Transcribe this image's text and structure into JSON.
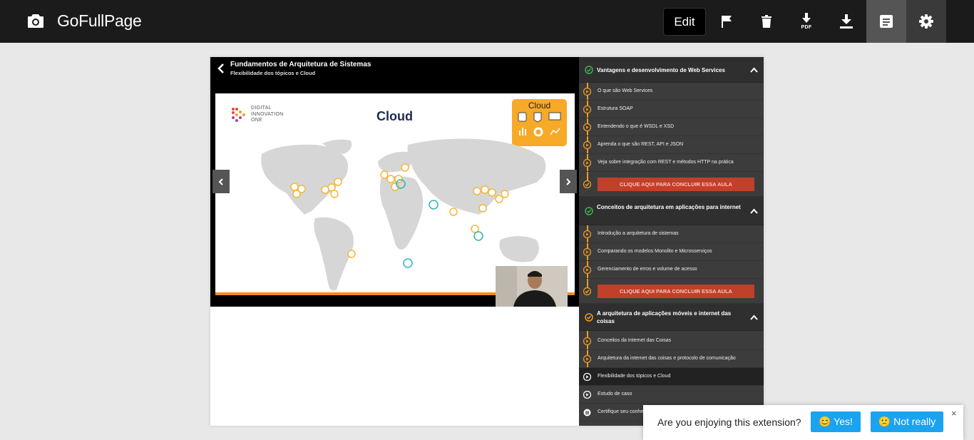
{
  "app": {
    "title": "GoFullPage",
    "edit_label": "Edit",
    "pdf_label": "PDF"
  },
  "course": {
    "title": "Fundamentos de Arquitetura de Sistemas",
    "subtitle": "Flexibilidade dos tópicos e Cloud"
  },
  "slide": {
    "title": "Cloud",
    "badge_label": "Cloud",
    "logo_lines": [
      "DIGITAL",
      "INNOVATION",
      "ONE"
    ]
  },
  "sections": [
    {
      "title": "Vantagens e desenvolvimento de Web Services",
      "status": "complete",
      "lessons": [
        "O que são Web Services",
        "Estrutura SOAP",
        "Entendendo o que é WSDL e XSD",
        "Aprenda o que são REST, API e JSON",
        "Veja sobre integração com REST e métodos HTTP na prática"
      ],
      "cta": "CLIQUE AQUI PARA CONCLUIR ESSA AULA"
    },
    {
      "title": "Conceitos de arquitetura em aplicações para internet",
      "status": "complete",
      "lessons": [
        "Introdução a arquitetura de sistemas",
        "Comparando os modelos Monolito e Microsserviços",
        "Gerenciamento de erros e volume de acesso"
      ],
      "cta": "CLIQUE AQUI PARA CONCLUIR ESSA AULA"
    },
    {
      "title": "A arquitetura de aplicações móveis e internet das coisas",
      "status": "in-progress",
      "lessons": [
        "Conceitos da Internet das Coisas",
        "Arquitetura da internet das coisas e protocolo de comunicação",
        "Flexibilidade dos tópicos e Cloud",
        "Estudo de caso",
        "Certifique seu conhecimento"
      ]
    }
  ],
  "feedback": {
    "question": "Are you enjoying this extension?",
    "yes_label": "😊 Yes!",
    "no_label": "🙁 Not really",
    "close": "×"
  },
  "colors": {
    "toolbar_bg": "#1b1b1b",
    "accent_orange": "#f29a1e",
    "cta_red": "#c0402a",
    "feedback_blue": "#1aa3f0",
    "check_green": "#39b54a"
  }
}
